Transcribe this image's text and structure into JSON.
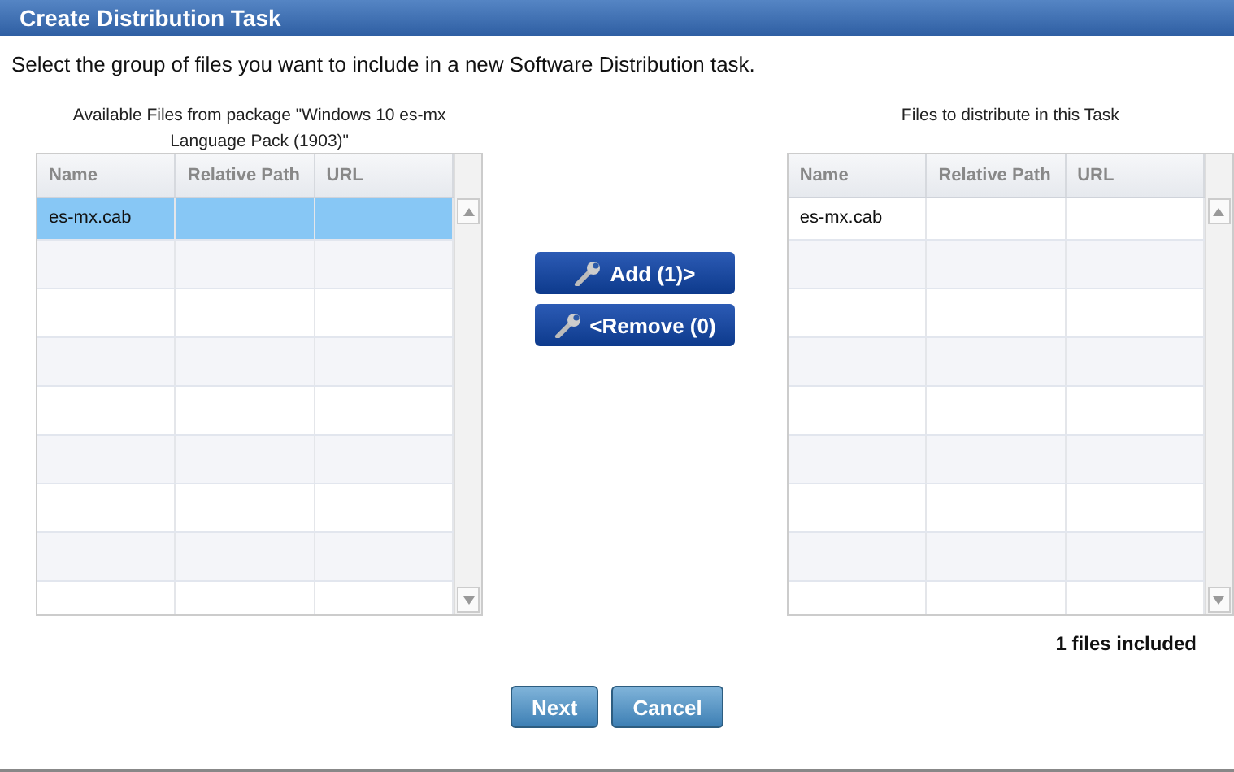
{
  "window": {
    "title": "Create Distribution Task"
  },
  "instruction": "Select the group of files you want to include in a new Software Distribution task.",
  "available": {
    "caption": "Available Files from package \"Windows 10 es-mx Language Pack (1903)\"",
    "columns": [
      "Name",
      "Relative Path",
      "URL"
    ],
    "rows": [
      {
        "cells": [
          "es-mx.cab"
        ],
        "selected": true
      }
    ]
  },
  "actions": [
    {
      "label": "Add (1)>"
    },
    {
      "label": "<Remove (0)"
    }
  ],
  "distribute": {
    "caption": "Files to distribute in this Task",
    "columns": [
      "Name",
      "Relative Path",
      "URL"
    ],
    "rows": [
      {
        "cells": [
          "es-mx.cab"
        ],
        "selected": false
      }
    ]
  },
  "summary": "1 files included",
  "buttons": [
    "Next",
    "Cancel"
  ]
}
